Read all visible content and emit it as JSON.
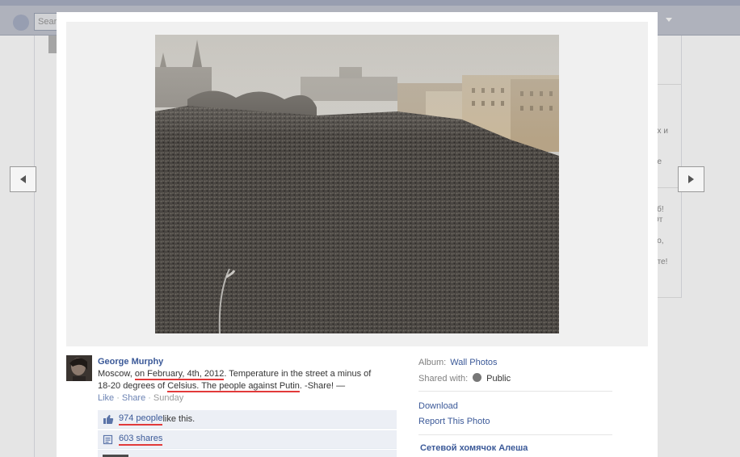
{
  "background": {
    "search_placeholder": "Sear",
    "right_fragments": [
      "х",
      "ах и",
      "а",
      "ре",
      "е",
      "уб!",
      "От",
      "во,",
      "ите!"
    ]
  },
  "viewer": {
    "owner_name": "George Murphy",
    "caption": {
      "part1": "Moscow, ",
      "part2": "on February, 4th, 2012",
      "part3": ". Temperature in the street a minus of 18-20 degrees of ",
      "part4": "Celsius. The people against Putin",
      "part5": ". -Share! —"
    },
    "actions": {
      "like": "Like",
      "share": "Share",
      "time": "Sunday"
    },
    "likes": {
      "link": "974 people",
      "suffix": " like this."
    },
    "shares": {
      "link": "603 shares"
    },
    "meta": {
      "album_label": "Album:",
      "album_value": "Wall Photos",
      "shared_label": "Shared with:",
      "shared_value": "Public"
    },
    "links": {
      "download": "Download",
      "report": "Report This Photo"
    },
    "album_owner": "Сетевой хомячок Алеша"
  },
  "colors": {
    "link": "#3b5998",
    "annotation": "#e23a3a",
    "ufi_bg": "#eceff5"
  },
  "icons": {
    "prev": "triangle-left",
    "next": "triangle-right",
    "like": "thumbs-up",
    "share": "share-sheet",
    "audience": "globe"
  }
}
